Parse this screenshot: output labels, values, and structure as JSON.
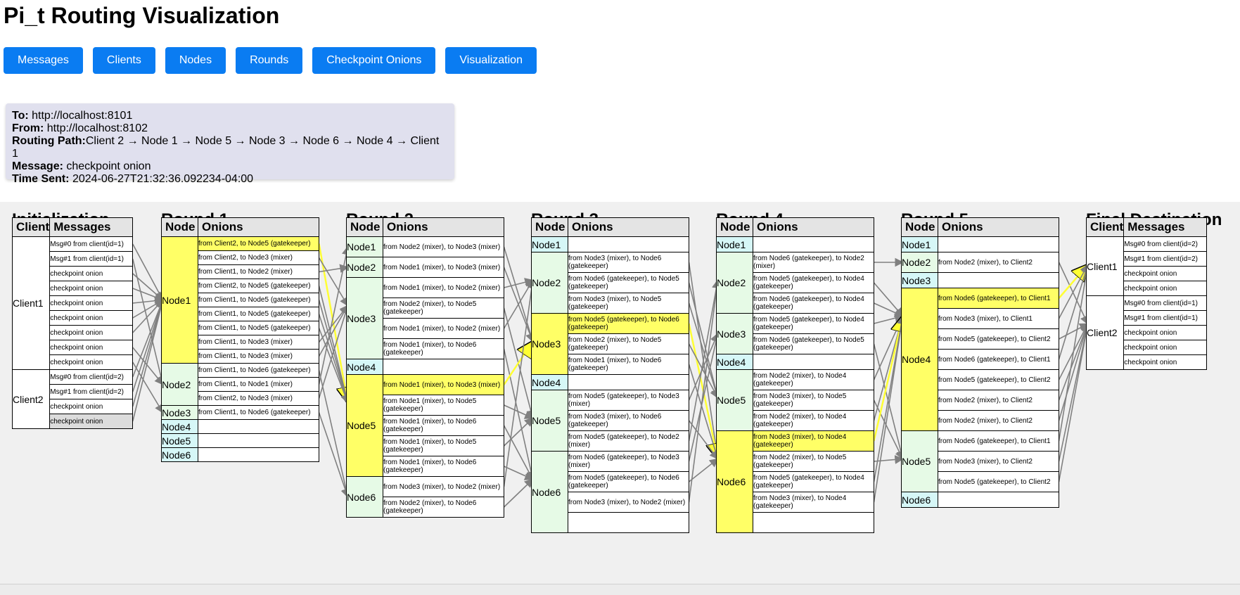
{
  "title": "Pi_t Routing Visualization",
  "nav": [
    "Messages",
    "Clients",
    "Nodes",
    "Rounds",
    "Checkpoint Onions",
    "Visualization"
  ],
  "info": {
    "to_label": "To:",
    "to": "http://localhost:8101",
    "from_label": "From:",
    "from": "http://localhost:8102",
    "path_label": "Routing Path:",
    "path": "Client 2 → Node 1 → Node 5 → Node 3 → Node 6 → Node 4 → Client 1",
    "message_label": "Message:",
    "message": "checkpoint onion",
    "time_label": "Time Sent:",
    "time": "2024-06-27T21:32:36.092234-04:00"
  },
  "colors": {
    "button": "#0a7cf2",
    "highlight": "#ffff66",
    "route_node": "#e6fae6",
    "idle_node": "#d6f7f7",
    "arrow": "#808080"
  },
  "init": {
    "title": "Initialization",
    "headers": [
      "Client",
      "Messages"
    ],
    "groups": [
      {
        "client": "Client1",
        "messages": [
          "Msg#0 from client(id=1)",
          "Msg#1 from client(id=1)",
          "checkpoint onion",
          "checkpoint onion",
          "checkpoint onion",
          "checkpoint onion",
          "checkpoint onion",
          "checkpoint onion",
          "checkpoint onion"
        ]
      },
      {
        "client": "Client2",
        "messages": [
          "Msg#0 from client(id=2)",
          "Msg#1 from client(id=2)",
          "checkpoint onion",
          "checkpoint onion"
        ]
      }
    ]
  },
  "rounds": [
    {
      "title": "Round 1",
      "headers": [
        "Node",
        "Onions"
      ],
      "nodes": [
        {
          "name": "Node1",
          "onions": [
            "from Client2, to Node5 (gatekeeper)",
            "from Client2, to Node3 (mixer)",
            "from Client1, to Node2 (mixer)",
            "from Client2, to Node5 (gatekeeper)",
            "from Client1, to Node5 (gatekeeper)",
            "from Client1, to Node5 (gatekeeper)",
            "from Client1, to Node5 (gatekeeper)",
            "from Client1, to Node3 (mixer)",
            "from Client1, to Node3 (mixer)"
          ]
        },
        {
          "name": "Node2",
          "onions": [
            "from Client1, to Node6 (gatekeeper)",
            "from Client1, to Node1 (mixer)",
            "from Client2, to Node3 (mixer)"
          ]
        },
        {
          "name": "Node3",
          "onions": [
            "from Client1, to Node6 (gatekeeper)"
          ]
        },
        {
          "name": "Node4",
          "onions": []
        },
        {
          "name": "Node5",
          "onions": []
        },
        {
          "name": "Node6",
          "onions": []
        }
      ]
    },
    {
      "title": "Round 2",
      "headers": [
        "Node",
        "Onions"
      ],
      "nodes": [
        {
          "name": "Node1",
          "onions": [
            "from Node2 (mixer), to Node3 (mixer)"
          ]
        },
        {
          "name": "Node2",
          "onions": [
            "from Node1 (mixer), to Node3 (mixer)"
          ]
        },
        {
          "name": "Node3",
          "onions": [
            "from Node1 (mixer), to Node2 (mixer)",
            "from Node2 (mixer), to Node5 (gatekeeper)",
            "from Node1 (mixer), to Node2 (mixer)",
            "from Node1 (mixer), to Node6 (gatekeeper)"
          ]
        },
        {
          "name": "Node4",
          "onions": []
        },
        {
          "name": "Node5",
          "onions": [
            "from Node1 (mixer), to Node3 (mixer)",
            "from Node1 (mixer), to Node5 (gatekeeper)",
            "from Node1 (mixer), to Node6 (gatekeeper)",
            "from Node1 (mixer), to Node5 (gatekeeper)",
            "from Node1 (mixer), to Node6 (gatekeeper)"
          ]
        },
        {
          "name": "Node6",
          "onions": [
            "from Node3 (mixer), to Node2 (mixer)",
            "from Node2 (mixer), to Node6 (gatekeeper)"
          ]
        }
      ]
    },
    {
      "title": "Round 3",
      "headers": [
        "Node",
        "Onions"
      ],
      "nodes": [
        {
          "name": "Node1",
          "onions": []
        },
        {
          "name": "Node2",
          "onions": [
            "from Node3 (mixer), to Node6 (gatekeeper)",
            "from Node6 (gatekeeper), to Node5 (gatekeeper)",
            "from Node3 (mixer), to Node5 (gatekeeper)"
          ]
        },
        {
          "name": "Node3",
          "onions": [
            "from Node5 (gatekeeper), to Node6 (gatekeeper)",
            "from Node2 (mixer), to Node5 (gatekeeper)",
            "from Node1 (mixer), to Node6 (gatekeeper)"
          ]
        },
        {
          "name": "Node4",
          "onions": []
        },
        {
          "name": "Node5",
          "onions": [
            "from Node5 (gatekeeper), to Node3 (mixer)",
            "from Node3 (mixer), to Node6 (gatekeeper)",
            "from Node5 (gatekeeper), to Node2 (mixer)"
          ]
        },
        {
          "name": "Node6",
          "onions": [
            "from Node6 (gatekeeper), to Node3 (mixer)",
            "from Node5 (gatekeeper), to Node6 (gatekeeper)",
            "from Node3 (mixer), to Node2 (mixer)",
            ""
          ]
        }
      ]
    },
    {
      "title": "Round 4",
      "headers": [
        "Node",
        "Onions"
      ],
      "nodes": [
        {
          "name": "Node1",
          "onions": []
        },
        {
          "name": "Node2",
          "onions": [
            "from Node6 (gatekeeper), to Node2 (mixer)",
            "from Node5 (gatekeeper), to Node4 (gatekeeper)",
            "from Node6 (gatekeeper), to Node4 (gatekeeper)"
          ]
        },
        {
          "name": "Node3",
          "onions": [
            "from Node5 (gatekeeper), to Node4 (gatekeeper)",
            "from Node6 (gatekeeper), to Node5 (gatekeeper)"
          ]
        },
        {
          "name": "Node4",
          "onions": []
        },
        {
          "name": "Node5",
          "onions": [
            "from Node2 (mixer), to Node4 (gatekeeper)",
            "from Node3 (mixer), to Node5 (gatekeeper)",
            "from Node2 (mixer), to Node4 (gatekeeper)"
          ]
        },
        {
          "name": "Node6",
          "onions": [
            "from Node3 (mixer), to Node4 (gatekeeper)",
            "from Node2 (mixer), to Node5 (gatekeeper)",
            "from Node5 (gatekeeper), to Node4 (gatekeeper)",
            "from Node3 (mixer), to Node4 (gatekeeper)",
            ""
          ]
        }
      ]
    },
    {
      "title": "Round 5",
      "headers": [
        "Node",
        "Onions"
      ],
      "nodes": [
        {
          "name": "Node1",
          "onions": []
        },
        {
          "name": "Node2",
          "onions": [
            "from Node2 (mixer), to Client2"
          ]
        },
        {
          "name": "Node3",
          "onions": []
        },
        {
          "name": "Node4",
          "onions": [
            "from Node6 (gatekeeper), to Client1",
            "from Node3 (mixer), to Client1",
            "from Node5 (gatekeeper), to Client2",
            "from Node6 (gatekeeper), to Client1",
            "from Node5 (gatekeeper), to Client2",
            "from Node2 (mixer), to Client2",
            "from Node2 (mixer), to Client2"
          ]
        },
        {
          "name": "Node5",
          "onions": [
            "from Node6 (gatekeeper), to Client1",
            "from Node3 (mixer), to Client2",
            "from Node5 (gatekeeper), to Client2"
          ]
        },
        {
          "name": "Node6",
          "onions": []
        }
      ]
    }
  ],
  "final": {
    "title": "Final Destination",
    "headers": [
      "Client",
      "Messages"
    ],
    "groups": [
      {
        "client": "Client1",
        "messages": [
          "Msg#0 from client(id=2)",
          "Msg#1 from client(id=2)",
          "checkpoint onion",
          "checkpoint onion"
        ]
      },
      {
        "client": "Client2",
        "messages": [
          "Msg#0 from client(id=1)",
          "Msg#1 from client(id=1)",
          "checkpoint onion",
          "checkpoint onion",
          "checkpoint onion"
        ]
      }
    ]
  }
}
